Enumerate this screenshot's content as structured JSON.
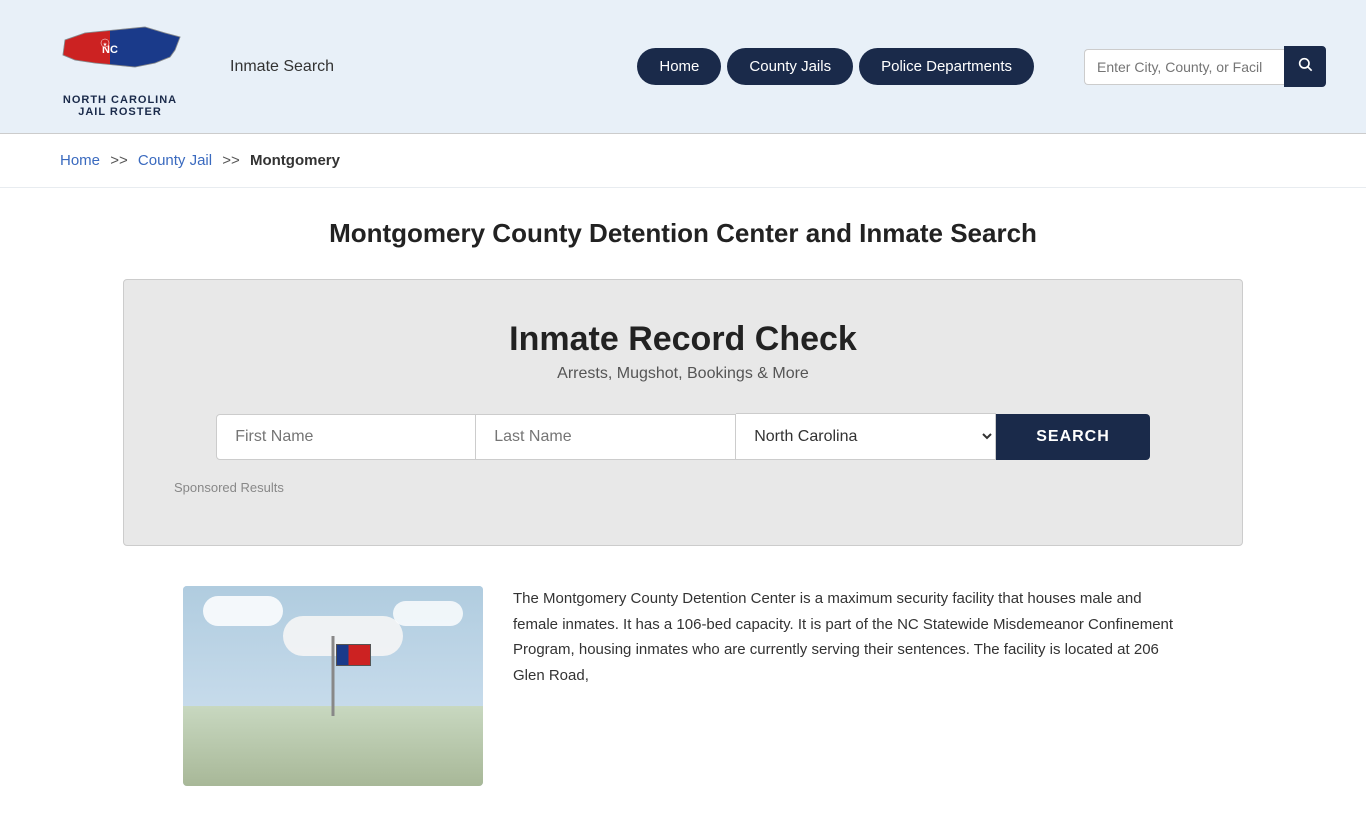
{
  "header": {
    "logo_line1": "NORTH CAROLINA",
    "logo_line2": "JAIL ROSTER",
    "inmate_search_label": "Inmate Search",
    "nav": {
      "home_label": "Home",
      "county_jails_label": "County Jails",
      "police_departments_label": "Police Departments"
    },
    "search_placeholder": "Enter City, County, or Facil"
  },
  "breadcrumb": {
    "home_label": "Home",
    "separator1": ">>",
    "county_jail_label": "County Jail",
    "separator2": ">>",
    "current": "Montgomery"
  },
  "page_title": "Montgomery County Detention Center and Inmate Search",
  "record_check": {
    "title": "Inmate Record Check",
    "subtitle": "Arrests, Mugshot, Bookings & More",
    "first_name_placeholder": "First Name",
    "last_name_placeholder": "Last Name",
    "state_selected": "North Carolina",
    "search_button_label": "SEARCH",
    "sponsored_label": "Sponsored Results"
  },
  "description": {
    "text": "The Montgomery County Detention Center is a maximum security facility that houses male and female inmates. It has a 106-bed capacity. It is part of the NC Statewide Misdemeanor Confinement Program, housing inmates who are currently serving their sentences. The facility is located at 206 Glen Road,"
  }
}
